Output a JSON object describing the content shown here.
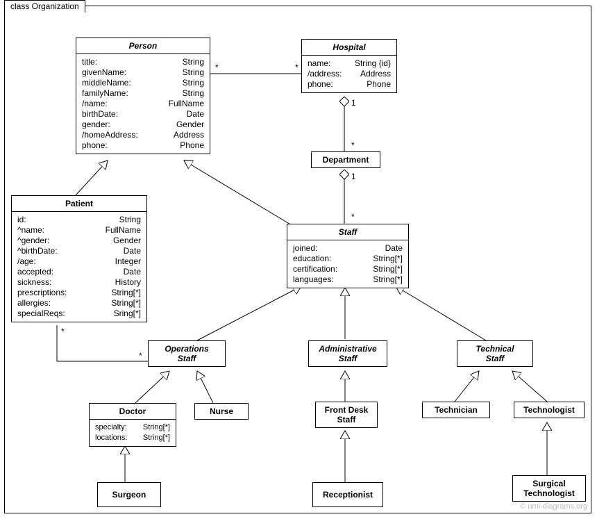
{
  "frame_title": "class Organization",
  "watermark": "© uml-diagrams.org",
  "classes": {
    "person": {
      "name": "Person",
      "attrs": [
        {
          "k": "title:",
          "t": "String"
        },
        {
          "k": "givenName:",
          "t": "String"
        },
        {
          "k": "middleName:",
          "t": "String"
        },
        {
          "k": "familyName:",
          "t": "String"
        },
        {
          "k": "/name:",
          "t": "FullName"
        },
        {
          "k": "birthDate:",
          "t": "Date"
        },
        {
          "k": "gender:",
          "t": "Gender"
        },
        {
          "k": "/homeAddress:",
          "t": "Address"
        },
        {
          "k": "phone:",
          "t": "Phone"
        }
      ]
    },
    "hospital": {
      "name": "Hospital",
      "attrs": [
        {
          "k": "name:",
          "t": "String {id}"
        },
        {
          "k": "/address:",
          "t": "Address"
        },
        {
          "k": "phone:",
          "t": "Phone"
        }
      ]
    },
    "department": {
      "name": "Department"
    },
    "patient": {
      "name": "Patient",
      "attrs": [
        {
          "k": "id:",
          "t": "String"
        },
        {
          "k": "^name:",
          "t": "FullName"
        },
        {
          "k": "^gender:",
          "t": "Gender"
        },
        {
          "k": "^birthDate:",
          "t": "Date"
        },
        {
          "k": "/age:",
          "t": "Integer"
        },
        {
          "k": "accepted:",
          "t": "Date"
        },
        {
          "k": "sickness:",
          "t": "History"
        },
        {
          "k": "prescriptions:",
          "t": "String[*]"
        },
        {
          "k": "allergies:",
          "t": "String[*]"
        },
        {
          "k": "specialReqs:",
          "t": "Sring[*]"
        }
      ]
    },
    "staff": {
      "name": "Staff",
      "attrs": [
        {
          "k": "joined:",
          "t": "Date"
        },
        {
          "k": "education:",
          "t": "String[*]"
        },
        {
          "k": "certification:",
          "t": "String[*]"
        },
        {
          "k": "languages:",
          "t": "String[*]"
        }
      ]
    },
    "operations_staff": {
      "name": "Operations\nStaff"
    },
    "administrative_staff": {
      "name": "Administrative\nStaff"
    },
    "technical_staff": {
      "name": "Technical\nStaff"
    },
    "doctor": {
      "name": "Doctor",
      "attrs": [
        {
          "k": "specialty:",
          "t": "String[*]"
        },
        {
          "k": "locations:",
          "t": "String[*]"
        }
      ]
    },
    "nurse": {
      "name": "Nurse"
    },
    "front_desk_staff": {
      "name": "Front Desk\nStaff"
    },
    "technician": {
      "name": "Technician"
    },
    "technologist": {
      "name": "Technologist"
    },
    "surgeon": {
      "name": "Surgeon"
    },
    "receptionist": {
      "name": "Receptionist"
    },
    "surgical_technologist": {
      "name": "Surgical\nTechnologist"
    }
  },
  "multiplicities": {
    "star1": "*",
    "star2": "*",
    "one1": "1",
    "star3": "*",
    "one2": "1",
    "star4": "*",
    "star5": "*",
    "star6": "*"
  }
}
